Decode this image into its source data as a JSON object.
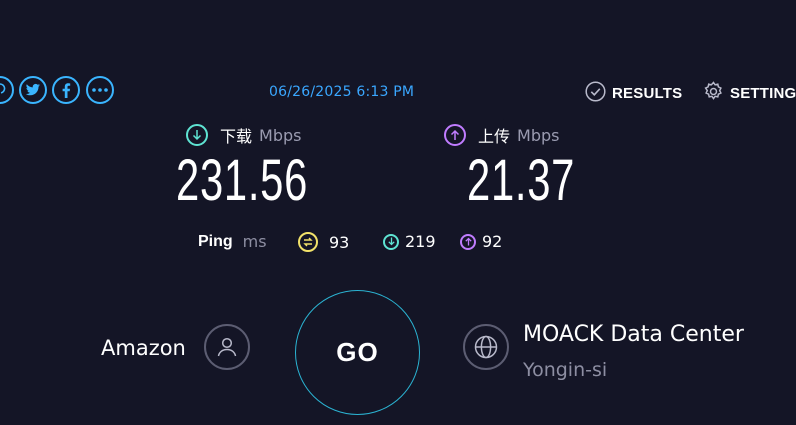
{
  "share": {
    "icons": [
      "pinterest-icon",
      "twitter-icon",
      "facebook-icon",
      "more-icon"
    ]
  },
  "header": {
    "timestamp": "06/26/2025 6:13 PM",
    "results_label": "RESULTS",
    "settings_label": "SETTINGS"
  },
  "download": {
    "label": "下载",
    "unit": "Mbps",
    "value": "231.56",
    "color": "#5ee3d2"
  },
  "upload": {
    "label": "上传",
    "unit": "Mbps",
    "value": "21.37",
    "color": "#c07cff"
  },
  "ping": {
    "label": "Ping",
    "unit": "ms",
    "idle": "93",
    "download": "219",
    "upload": "92",
    "idle_color": "#f2e26a"
  },
  "isp": {
    "name": "Amazon"
  },
  "go": {
    "label": "GO",
    "ring_color": "#2bb3d2"
  },
  "server": {
    "name": "MOACK Data Center",
    "location": "Yongin-si"
  }
}
